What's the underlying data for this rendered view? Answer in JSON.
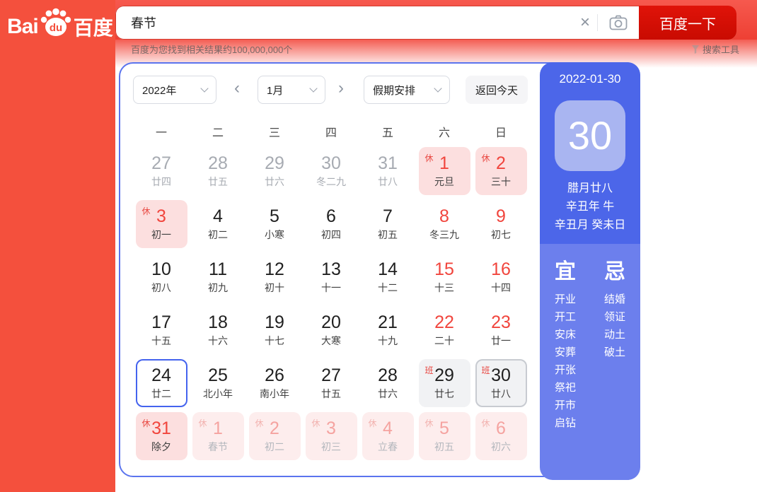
{
  "logo": {
    "bai": "Bai",
    "du": "du",
    "cn": "百度"
  },
  "search": {
    "query": "春节",
    "clear_icon": "×",
    "button": "百度一下"
  },
  "results_bar": {
    "stats": "百度为您找到相关结果约100,000,000个",
    "tools": "搜索工具"
  },
  "toolbar": {
    "year": "2022年",
    "month": "1月",
    "holiday": "假期安排",
    "today_button": "返回今天",
    "prev": "‹",
    "next": "›"
  },
  "calendar": {
    "weekdays": [
      "一",
      "二",
      "三",
      "四",
      "五",
      "六",
      "日"
    ],
    "cells": [
      {
        "day": "27",
        "lunar": "廿四",
        "classes": "prev",
        "badge": ""
      },
      {
        "day": "28",
        "lunar": "廿五",
        "classes": "prev",
        "badge": ""
      },
      {
        "day": "29",
        "lunar": "廿六",
        "classes": "prev",
        "badge": ""
      },
      {
        "day": "30",
        "lunar": "冬二九",
        "classes": "prev",
        "badge": ""
      },
      {
        "day": "31",
        "lunar": "廿八",
        "classes": "prev",
        "badge": ""
      },
      {
        "day": "1",
        "lunar": "元旦",
        "classes": "rest",
        "badge": "休"
      },
      {
        "day": "2",
        "lunar": "三十",
        "classes": "rest",
        "badge": "休"
      },
      {
        "day": "3",
        "lunar": "初一",
        "classes": "rest",
        "badge": "休"
      },
      {
        "day": "4",
        "lunar": "初二",
        "classes": "",
        "badge": ""
      },
      {
        "day": "5",
        "lunar": "小寒",
        "classes": "",
        "badge": ""
      },
      {
        "day": "6",
        "lunar": "初四",
        "classes": "",
        "badge": ""
      },
      {
        "day": "7",
        "lunar": "初五",
        "classes": "",
        "badge": ""
      },
      {
        "day": "8",
        "lunar": "冬三九",
        "classes": "wknd",
        "badge": ""
      },
      {
        "day": "9",
        "lunar": "初七",
        "classes": "wknd",
        "badge": ""
      },
      {
        "day": "10",
        "lunar": "初八",
        "classes": "",
        "badge": ""
      },
      {
        "day": "11",
        "lunar": "初九",
        "classes": "",
        "badge": ""
      },
      {
        "day": "12",
        "lunar": "初十",
        "classes": "",
        "badge": ""
      },
      {
        "day": "13",
        "lunar": "十一",
        "classes": "",
        "badge": ""
      },
      {
        "day": "14",
        "lunar": "十二",
        "classes": "",
        "badge": ""
      },
      {
        "day": "15",
        "lunar": "十三",
        "classes": "wknd",
        "badge": ""
      },
      {
        "day": "16",
        "lunar": "十四",
        "classes": "wknd",
        "badge": ""
      },
      {
        "day": "17",
        "lunar": "十五",
        "classes": "",
        "badge": ""
      },
      {
        "day": "18",
        "lunar": "十六",
        "classes": "",
        "badge": ""
      },
      {
        "day": "19",
        "lunar": "十七",
        "classes": "",
        "badge": ""
      },
      {
        "day": "20",
        "lunar": "大寒",
        "classes": "",
        "badge": ""
      },
      {
        "day": "21",
        "lunar": "十九",
        "classes": "",
        "badge": ""
      },
      {
        "day": "22",
        "lunar": "二十",
        "classes": "wknd",
        "badge": ""
      },
      {
        "day": "23",
        "lunar": "廿一",
        "classes": "wknd",
        "badge": ""
      },
      {
        "day": "24",
        "lunar": "廿二",
        "classes": "today",
        "badge": ""
      },
      {
        "day": "25",
        "lunar": "北小年",
        "classes": "",
        "badge": ""
      },
      {
        "day": "26",
        "lunar": "南小年",
        "classes": "",
        "badge": ""
      },
      {
        "day": "27",
        "lunar": "廿五",
        "classes": "",
        "badge": ""
      },
      {
        "day": "28",
        "lunar": "廿六",
        "classes": "",
        "badge": ""
      },
      {
        "day": "29",
        "lunar": "廿七",
        "classes": "shift",
        "badge": "班"
      },
      {
        "day": "30",
        "lunar": "廿八",
        "classes": "shift sel",
        "badge": "班"
      },
      {
        "day": "31",
        "lunar": "除夕",
        "classes": "rest",
        "badge": "休"
      },
      {
        "day": "1",
        "lunar": "春节",
        "classes": "next",
        "badge": "休"
      },
      {
        "day": "2",
        "lunar": "初二",
        "classes": "next",
        "badge": "休"
      },
      {
        "day": "3",
        "lunar": "初三",
        "classes": "next",
        "badge": "休"
      },
      {
        "day": "4",
        "lunar": "立春",
        "classes": "next",
        "badge": "休"
      },
      {
        "day": "5",
        "lunar": "初五",
        "classes": "next",
        "badge": "休"
      },
      {
        "day": "6",
        "lunar": "初六",
        "classes": "next",
        "badge": "休"
      }
    ]
  },
  "panel": {
    "date": "2022-01-30",
    "day": "30",
    "lunar_lines": [
      "腊月廿八",
      "辛丑年 牛",
      "辛丑月 癸未日"
    ],
    "yi_title": "宜",
    "ji_title": "忌",
    "yi": [
      "开业",
      "开工",
      "安床",
      "安葬",
      "开张",
      "祭祀",
      "开市",
      "启钻"
    ],
    "ji": [
      "结婚",
      "领证",
      "动土",
      "破土"
    ]
  },
  "colors": {
    "brand_red": "#f4503d",
    "button_red": "#d10c02",
    "panel_blue_top": "#4c66e9",
    "panel_blue_bottom": "#6c7fed",
    "today_border_blue": "#4463ee",
    "rest_pink": "#fcdfdf",
    "weekend_red": "#f1453d"
  }
}
